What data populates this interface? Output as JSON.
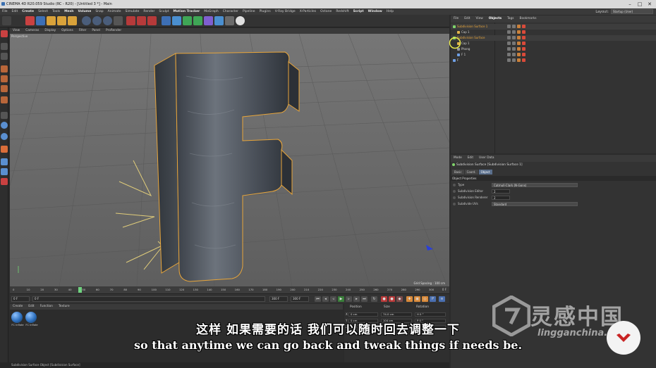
{
  "window": {
    "title": "CINEMA 4D R20.059 Studio (RC - R20) - [Untitled 3 *] - Main",
    "minimize": "–",
    "maximize": "□",
    "close": "✕"
  },
  "menubar": {
    "items": [
      "File",
      "Edit",
      "Create",
      "Select",
      "Tools",
      "Mesh",
      "Volume",
      "Snap",
      "Animate",
      "Simulate",
      "Render",
      "Sculpt",
      "Motion Tracker",
      "MoGraph",
      "Character",
      "Pipeline",
      "Plugins",
      "V-Ray Bridge",
      "X-Particles",
      "Octane",
      "Redshift",
      "Script",
      "Window",
      "Help"
    ],
    "highlighted": [
      "Create",
      "Mesh",
      "Volume",
      "Motion Tracker",
      "Script",
      "Window"
    ],
    "layout_label": "Layout:",
    "layout_value": "Startup (User)"
  },
  "viewport": {
    "menu": [
      "View",
      "Cameras",
      "Display",
      "Options",
      "Filter",
      "Panel",
      "ProRender"
    ],
    "label": "Perspective",
    "grid_spacing": "Grid Spacing : 100 cm"
  },
  "timeline": {
    "ticks": [
      "0",
      "10",
      "20",
      "30",
      "40",
      "50",
      "60",
      "70",
      "80",
      "90",
      "100",
      "110",
      "120",
      "130",
      "140",
      "150",
      "160",
      "170",
      "180",
      "190",
      "200",
      "210",
      "220",
      "230",
      "240",
      "250",
      "260",
      "270",
      "280",
      "290",
      "300"
    ],
    "current": "47 F",
    "playhead": 0.157,
    "end_label": "0 F"
  },
  "transport": {
    "start_frame": "0 F",
    "start_field": "0 F",
    "end_field": "300 F",
    "end_frame": "300 F"
  },
  "materials": {
    "menu": [
      "Create",
      "Edit",
      "Function",
      "Texture"
    ],
    "items": [
      "FC Inflate",
      "FC Inflate"
    ]
  },
  "coordinates": {
    "headers": [
      "Position",
      "Size",
      "Rotation"
    ],
    "rows": [
      {
        "axis": "X",
        "pos": "0 cm",
        "size": "74.0 cm",
        "rot": "H  0 °"
      },
      {
        "axis": "Y",
        "pos": "0 cm",
        "size": "104 cm",
        "rot": "P  0 °"
      },
      {
        "axis": "Z",
        "pos": "0 cm",
        "size": "10 cm",
        "rot": "B  0 °"
      }
    ]
  },
  "status": "Subdivision Surface Object [Subdivision Surface]",
  "object_manager": {
    "menu": [
      "File",
      "Edit",
      "View",
      "Objects",
      "Tags",
      "Bookmarks"
    ],
    "active_menu": "Objects",
    "objects": [
      {
        "name": "Subdivision Surface 1",
        "indent": 0,
        "color": "#7fd36b",
        "selected": true
      },
      {
        "name": "Cap 1",
        "indent": 1,
        "color": "#e2b34a",
        "selected": false
      },
      {
        "name": "Subdivision Surface",
        "indent": 0,
        "color": "#7fd36b",
        "selected": true
      },
      {
        "name": "Cap 1",
        "indent": 1,
        "color": "#e2b34a",
        "selected": false
      },
      {
        "name": "Phong",
        "indent": 1,
        "color": "#9a9a9a",
        "selected": false
      },
      {
        "name": "F 1",
        "indent": 1,
        "color": "#6fa0e6",
        "selected": false
      },
      {
        "name": "F",
        "indent": 0,
        "color": "#6fa0e6",
        "selected": false
      }
    ]
  },
  "attribute_manager": {
    "menu": [
      "Mode",
      "Edit",
      "User Data"
    ],
    "title": "Subdivision Surface [Subdivision Surface 1]",
    "tabs": [
      "Basic",
      "Coord.",
      "Object"
    ],
    "active_tab": "Object",
    "section": "Object Properties",
    "fields": [
      {
        "label": "Type",
        "value": "Catmull-Clark (N-Gons)",
        "kind": "drop"
      },
      {
        "label": "Subdivision Editor",
        "value": "2",
        "kind": "num"
      },
      {
        "label": "Subdivision Renderer",
        "value": "2",
        "kind": "num"
      },
      {
        "label": "Subdivide UVs",
        "value": "Standard",
        "kind": "drop"
      }
    ]
  },
  "subtitles": {
    "chinese": "这样 如果需要的话 我们可以随时回去调整一下",
    "english": "so that anytime we can go back and tweak things if needs be."
  },
  "watermark": {
    "brand": "灵感中国",
    "url": "lingganchina.com"
  },
  "colors": {
    "accent_blue": "#5a6f8c",
    "selection_orange": "#e8a53a",
    "object_green": "#7fd36b"
  }
}
